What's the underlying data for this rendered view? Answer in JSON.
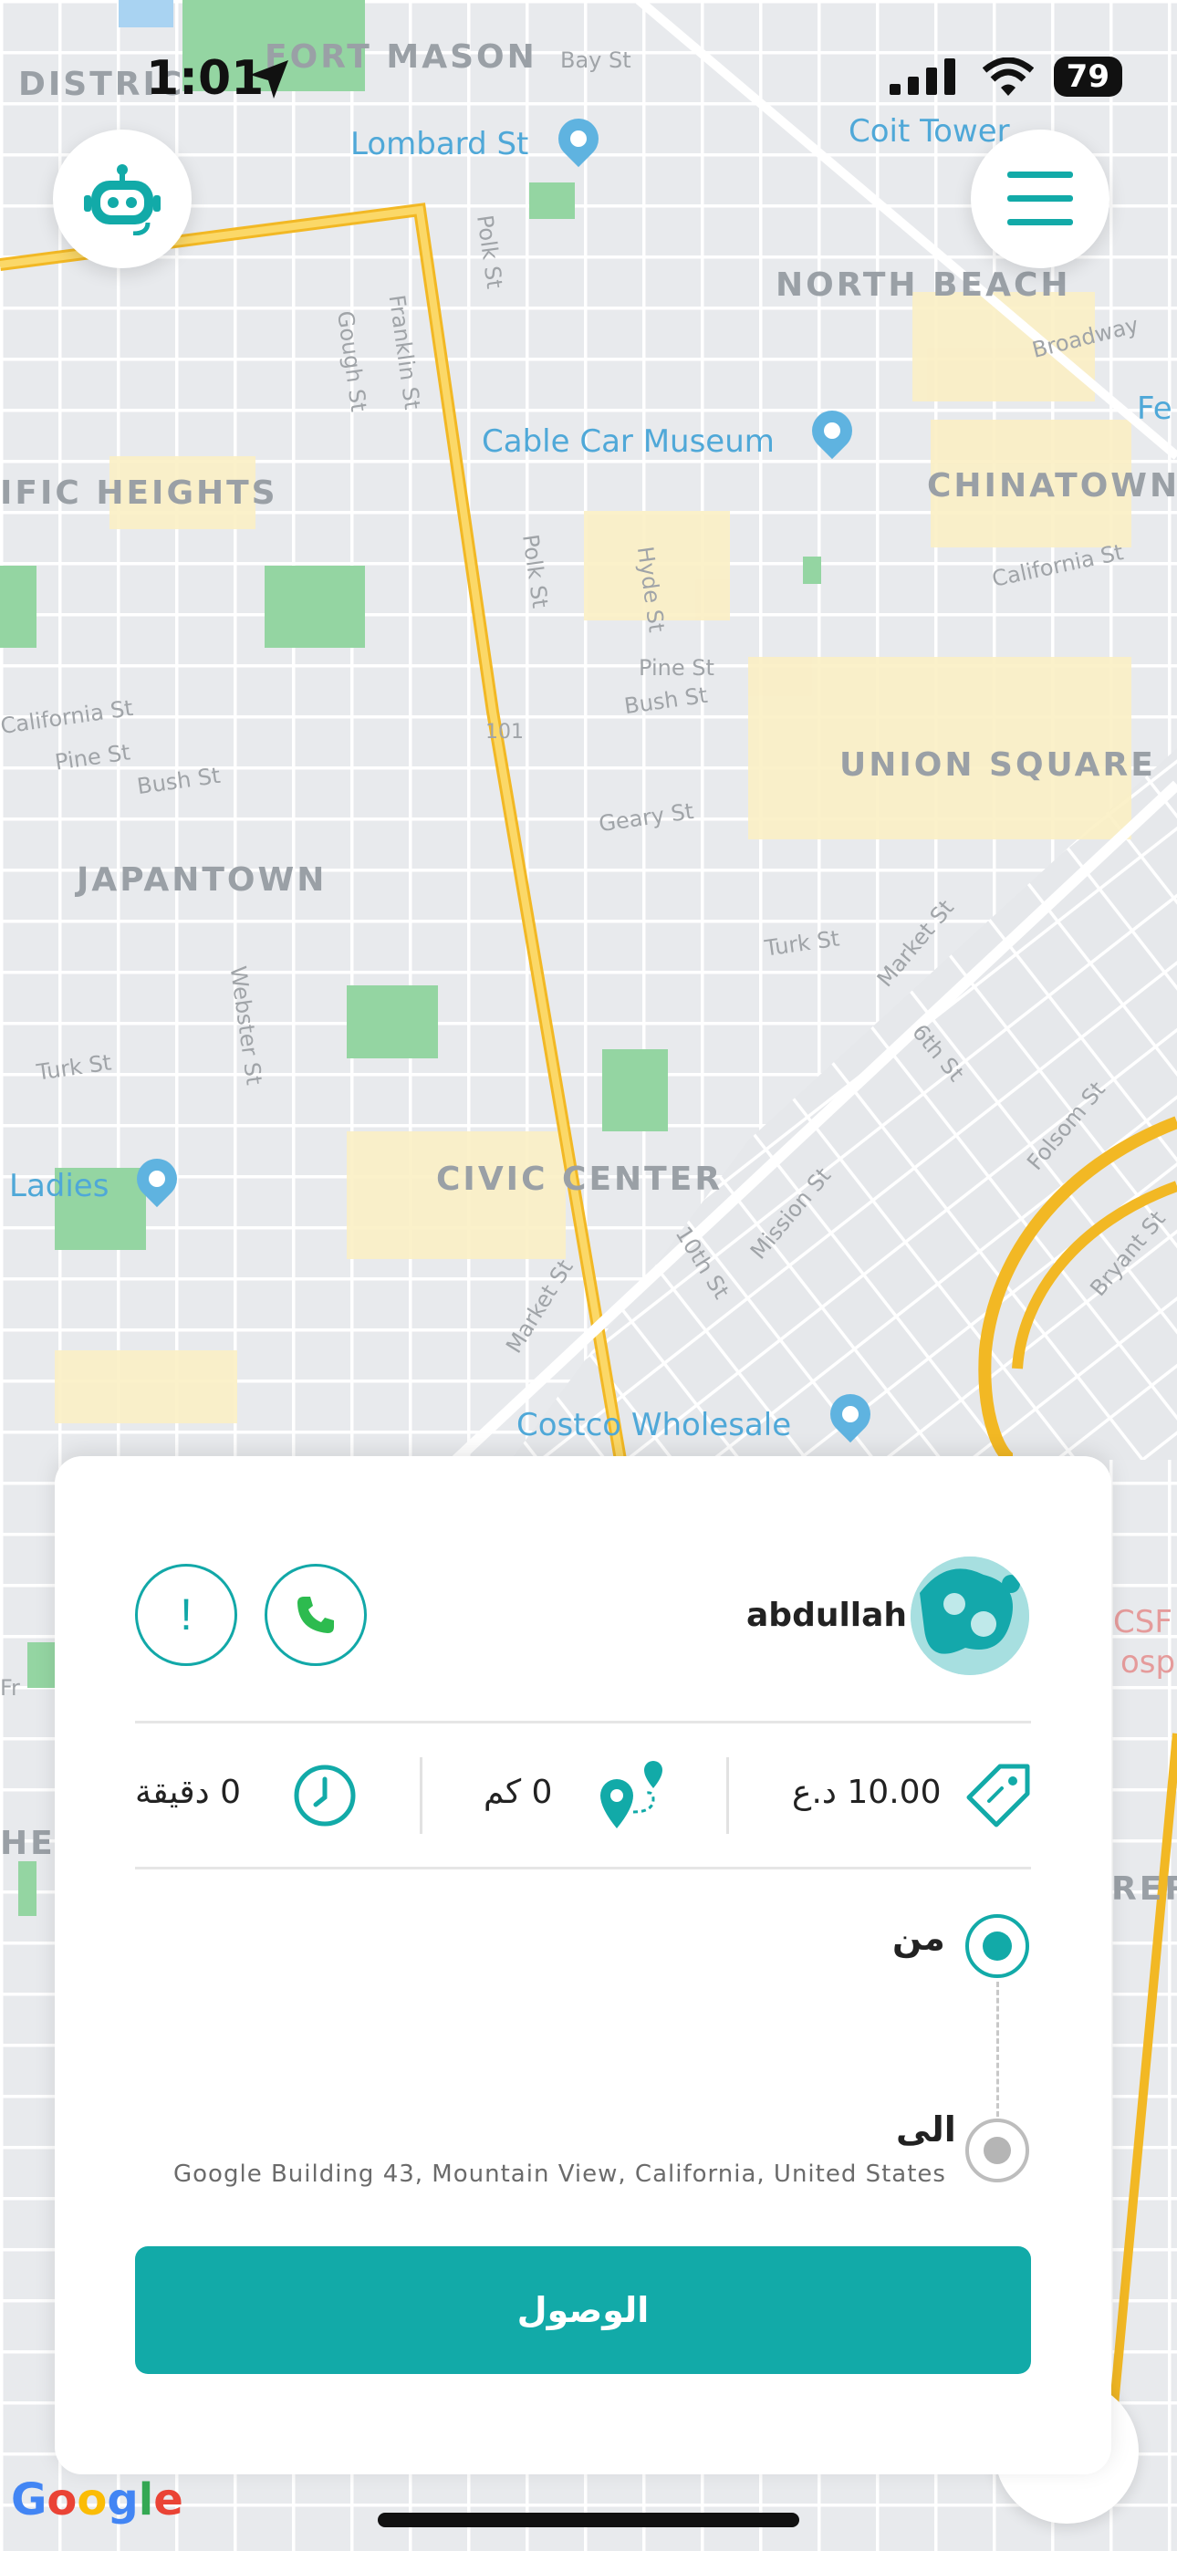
{
  "status_bar": {
    "time": "1:01",
    "battery": "79"
  },
  "map": {
    "districts": [
      "DISTRIC",
      "FORT MASON",
      "NORTH BEACH",
      "IFIC HEIGHTS",
      "CHINATOWN",
      "UNION SQUARE",
      "JAPANTOWN",
      "CIVIC CENTER",
      "HE",
      "RER"
    ],
    "pois": [
      "Lombard St",
      "Coit Tower",
      "Cable Car Museum",
      "Ladies",
      "Costco Wholesale",
      "CSF",
      "ospi",
      "Fe"
    ],
    "streets": [
      "Bay St",
      "Broadway",
      "California St",
      "Pine St",
      "Bush St",
      "Geary St",
      "Turk St",
      "Turk St",
      "California St",
      "Pine St",
      "Bush St",
      "Polk St",
      "Polk St",
      "Franklin St",
      "Gough St",
      "Hyde St",
      "Webster St",
      "Market St",
      "Market St",
      "10th St",
      "Mission St",
      "6th St",
      "Folsom St",
      "Bryant St",
      "Fr",
      "101"
    ],
    "provider": "Google"
  },
  "header": {
    "assistant_icon": "robot-icon",
    "menu_icon": "hamburger-menu-icon"
  },
  "card": {
    "driver_name": "abdullah",
    "actions": {
      "report_symbol": "!",
      "call_icon": "phone-icon"
    },
    "stats": {
      "price": "10.00 د.ع",
      "distance": "0 كم",
      "time": "0 دقيقة"
    },
    "route": {
      "from_label": "من",
      "to_label": "الى",
      "to_address": "Google Building 43, Mountain View, California, United States"
    },
    "arrive_button": "الوصول"
  },
  "colors": {
    "accent": "#12aaa8",
    "highway": "#f7c948",
    "park": "#8fd19e"
  }
}
